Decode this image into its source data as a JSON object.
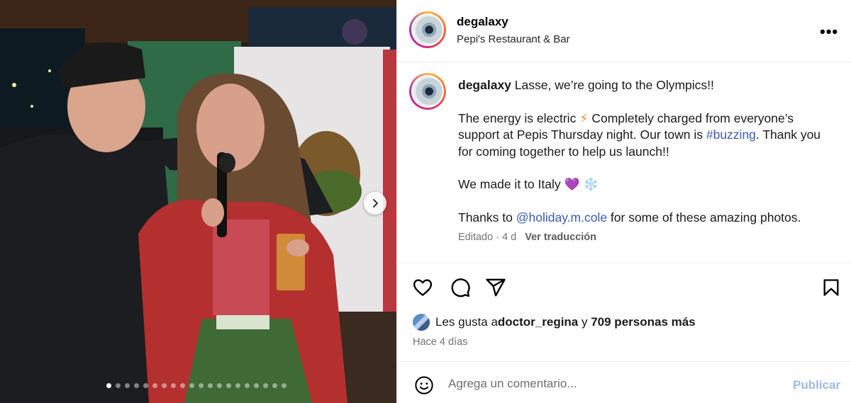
{
  "post": {
    "username": "degalaxy",
    "location": "Pepi's Restaurant & Bar",
    "more_icon": "more-horizontal-icon",
    "caption": {
      "username": "degalaxy",
      "line1": "Lasse, we’re going to the Olympics!!",
      "para2_before": "The energy is electric ",
      "para2_emoji": "⚡",
      "para2_mid": " Completely charged from everyone’s support at Pepis Thursday night. Our town is ",
      "hashtag": "#buzzing",
      "para2_after": ". Thank you for coming together to help us launch!!",
      "para3": "We made it to Italy ",
      "para3_emojis": "💜 ❄️",
      "para4_before": "Thanks to ",
      "mention": "@holiday.m.cole",
      "para4_after": " for some of these amazing photos."
    },
    "meta": {
      "edited": "Editado · 4 d",
      "translate": "Ver traducción"
    },
    "likes": {
      "prefix": "Les gusta a ",
      "user": "doctor_regina",
      "joiner": " y ",
      "others": "709 personas más"
    },
    "time_ago": "Hace 4 días",
    "comment": {
      "placeholder": "Agrega un comentario...",
      "publish": "Publicar"
    }
  },
  "carousel": {
    "current": 1,
    "total": 20
  },
  "colors": {
    "link": "#3b5bb5",
    "publish_disabled": "#9bbbe4",
    "muted": "#737373"
  },
  "icons": [
    "heart-icon",
    "comment-icon",
    "share-icon",
    "bookmark-icon",
    "emoji-icon",
    "chevron-right-icon"
  ]
}
